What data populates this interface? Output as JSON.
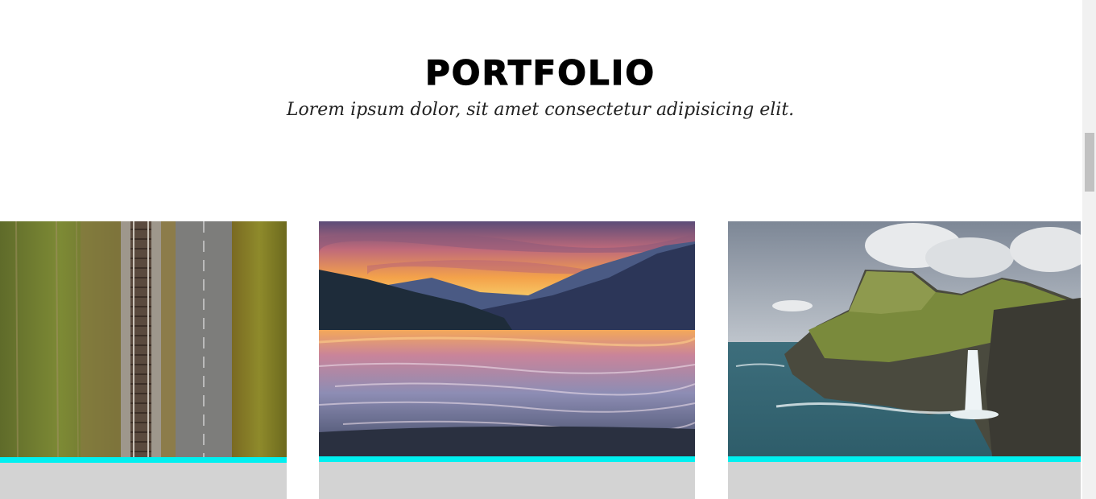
{
  "section": {
    "title": "PORTFOLIO",
    "subtitle": "Lorem ipsum dolor, sit amet consectetur adipisicing elit."
  },
  "colors": {
    "accent": "#00f0f0",
    "card_background": "#d3d3d3"
  },
  "portfolio_items": [
    {
      "image": "aerial-railway-photo"
    },
    {
      "image": "mountain-lake-sunset-photo"
    },
    {
      "image": "sea-cliff-waterfall-photo"
    }
  ]
}
